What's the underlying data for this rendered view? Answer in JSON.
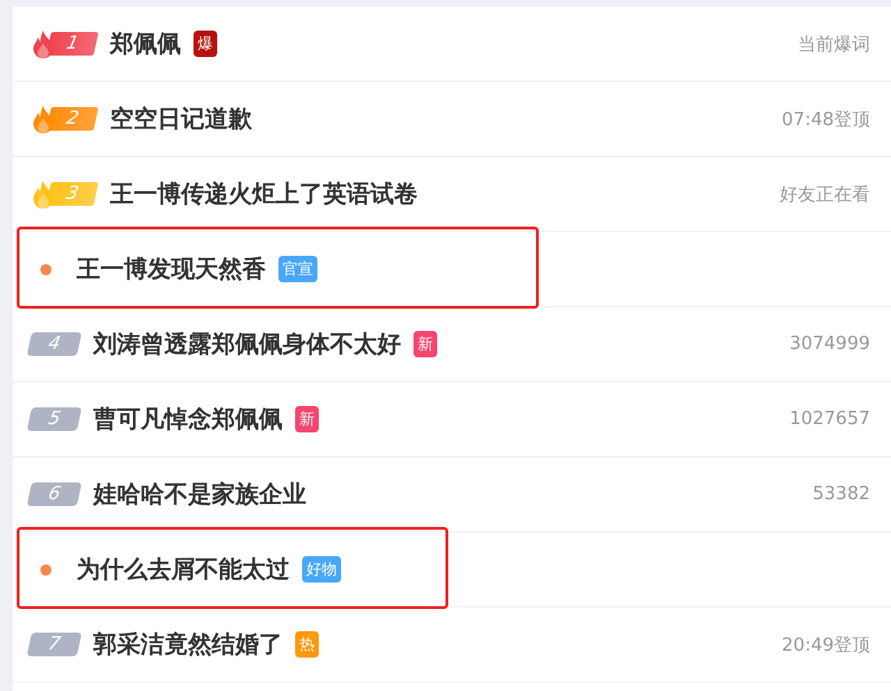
{
  "rows": [
    {
      "kind": "top",
      "rank": "1",
      "color": "#f0434f",
      "title": "郑佩佩",
      "tag": {
        "text": "爆",
        "color": "#b8120f"
      },
      "meta": "当前爆词",
      "highlighted": false
    },
    {
      "kind": "top",
      "rank": "2",
      "color": "#ff8c0a",
      "title": "空空日记道歉",
      "meta": "07:48登顶",
      "highlighted": false
    },
    {
      "kind": "top",
      "rank": "3",
      "color": "#ffc21c",
      "title": "王一博传递火炬上了英语试卷",
      "meta": "好友正在看",
      "highlighted": false
    },
    {
      "kind": "promo",
      "title": "王一博发现天然香",
      "tag": {
        "text": "官宣",
        "color": "#49a7f7"
      },
      "highlighted": true
    },
    {
      "kind": "rank",
      "rank": "4",
      "title": "刘涛曾透露郑佩佩身体不太好",
      "tag": {
        "text": "新",
        "color": "#f5466f"
      },
      "meta": "3074999",
      "highlighted": false
    },
    {
      "kind": "rank",
      "rank": "5",
      "title": "曹可凡悼念郑佩佩",
      "tag": {
        "text": "新",
        "color": "#f5466f"
      },
      "meta": "1027657",
      "highlighted": false
    },
    {
      "kind": "rank",
      "rank": "6",
      "title": "娃哈哈不是家族企业",
      "meta": "53382",
      "highlighted": false
    },
    {
      "kind": "promo",
      "title": "为什么去屑不能太过",
      "tag": {
        "text": "好物",
        "color": "#49a7f7"
      },
      "highlighted": true
    },
    {
      "kind": "rank",
      "rank": "7",
      "title": "郭采洁竟然结婚了",
      "tag": {
        "text": "热",
        "color": "#ff980f"
      },
      "meta": "20:49登顶",
      "highlighted": false
    }
  ]
}
